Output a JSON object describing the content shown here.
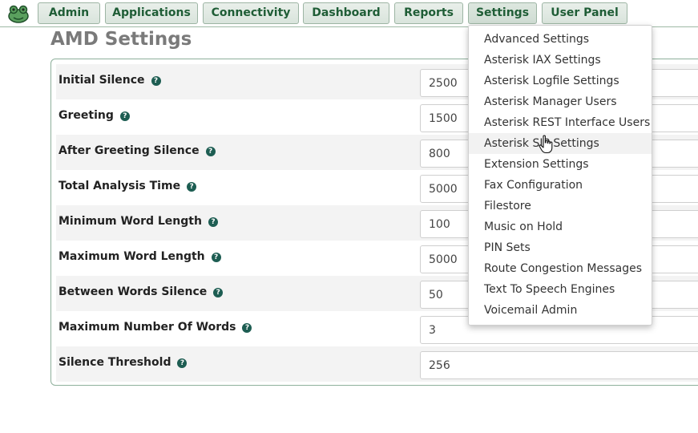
{
  "nav": {
    "items": [
      {
        "label": "Admin"
      },
      {
        "label": "Applications"
      },
      {
        "label": "Connectivity"
      },
      {
        "label": "Dashboard"
      },
      {
        "label": "Reports"
      },
      {
        "label": "Settings",
        "active": true
      },
      {
        "label": "User Panel"
      }
    ]
  },
  "page": {
    "title": "AMD Settings"
  },
  "settings": {
    "rows": [
      {
        "label": "Initial Silence",
        "value": "2500"
      },
      {
        "label": "Greeting",
        "value": "1500"
      },
      {
        "label": "After Greeting Silence",
        "value": "800"
      },
      {
        "label": "Total Analysis Time",
        "value": "5000"
      },
      {
        "label": "Minimum Word Length",
        "value": "100"
      },
      {
        "label": "Maximum Word Length",
        "value": "5000"
      },
      {
        "label": "Between Words Silence",
        "value": "50"
      },
      {
        "label": "Maximum Number Of Words",
        "value": "3"
      },
      {
        "label": "Silence Threshold",
        "value": "256"
      }
    ],
    "help_glyph": "?"
  },
  "dropdown": {
    "items": [
      {
        "label": "Advanced Settings"
      },
      {
        "label": "Asterisk IAX Settings"
      },
      {
        "label": "Asterisk Logfile Settings"
      },
      {
        "label": "Asterisk Manager Users"
      },
      {
        "label": "Asterisk REST Interface Users"
      },
      {
        "label": "Asterisk SIP Settings",
        "hovered": true
      },
      {
        "label": "Extension Settings"
      },
      {
        "label": "Fax Configuration"
      },
      {
        "label": "Filestore"
      },
      {
        "label": "Music on Hold"
      },
      {
        "label": "PIN Sets"
      },
      {
        "label": "Route Congestion Messages"
      },
      {
        "label": "Text To Speech Engines"
      },
      {
        "label": "Voicemail Admin"
      }
    ]
  },
  "icons": {
    "logo": "frog-logo-icon",
    "help": "help-circle-icon",
    "cursor": "hand-pointer-icon"
  },
  "colors": {
    "nav_text": "#1f5d36",
    "nav_border": "#9db5a4",
    "help_icon": "#1d5d52",
    "panel_border": "#8eb09b"
  }
}
